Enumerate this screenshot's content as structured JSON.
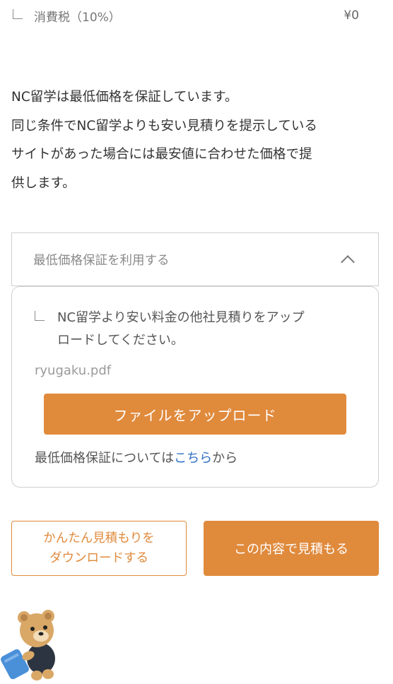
{
  "tax": {
    "label": "消費税（10%）",
    "amount": "¥0"
  },
  "guarantee": {
    "lines": [
      "NC留学は最低価格を保証しています。",
      "同じ条件でNC留学よりも安い見積りを提示している",
      "サイトがあった場合には最安値に合わせた価格で提",
      "供します。"
    ]
  },
  "accordion": {
    "label": "最低価格保証を利用する"
  },
  "upload": {
    "instruction_line1": "NC留学より安い料金の他社見積りをアップ",
    "instruction_line2": "ロードしてください。",
    "filename": "ryugaku.pdf",
    "button_label": "ファイルをアップロード",
    "note_before": "最低価格保証については",
    "note_link": "こちら",
    "note_after": "から"
  },
  "actions": {
    "download_line1": "かんたん見積もりを",
    "download_line2": "ダウンロードする",
    "estimate_label": "この内容で見積もる"
  },
  "colors": {
    "accent": "#e08a3c",
    "link": "#2f72c7",
    "border": "#cfcfcf"
  },
  "icons": {
    "mascot": "bear-mascot-icon",
    "chevron": "chevron-up-icon"
  }
}
